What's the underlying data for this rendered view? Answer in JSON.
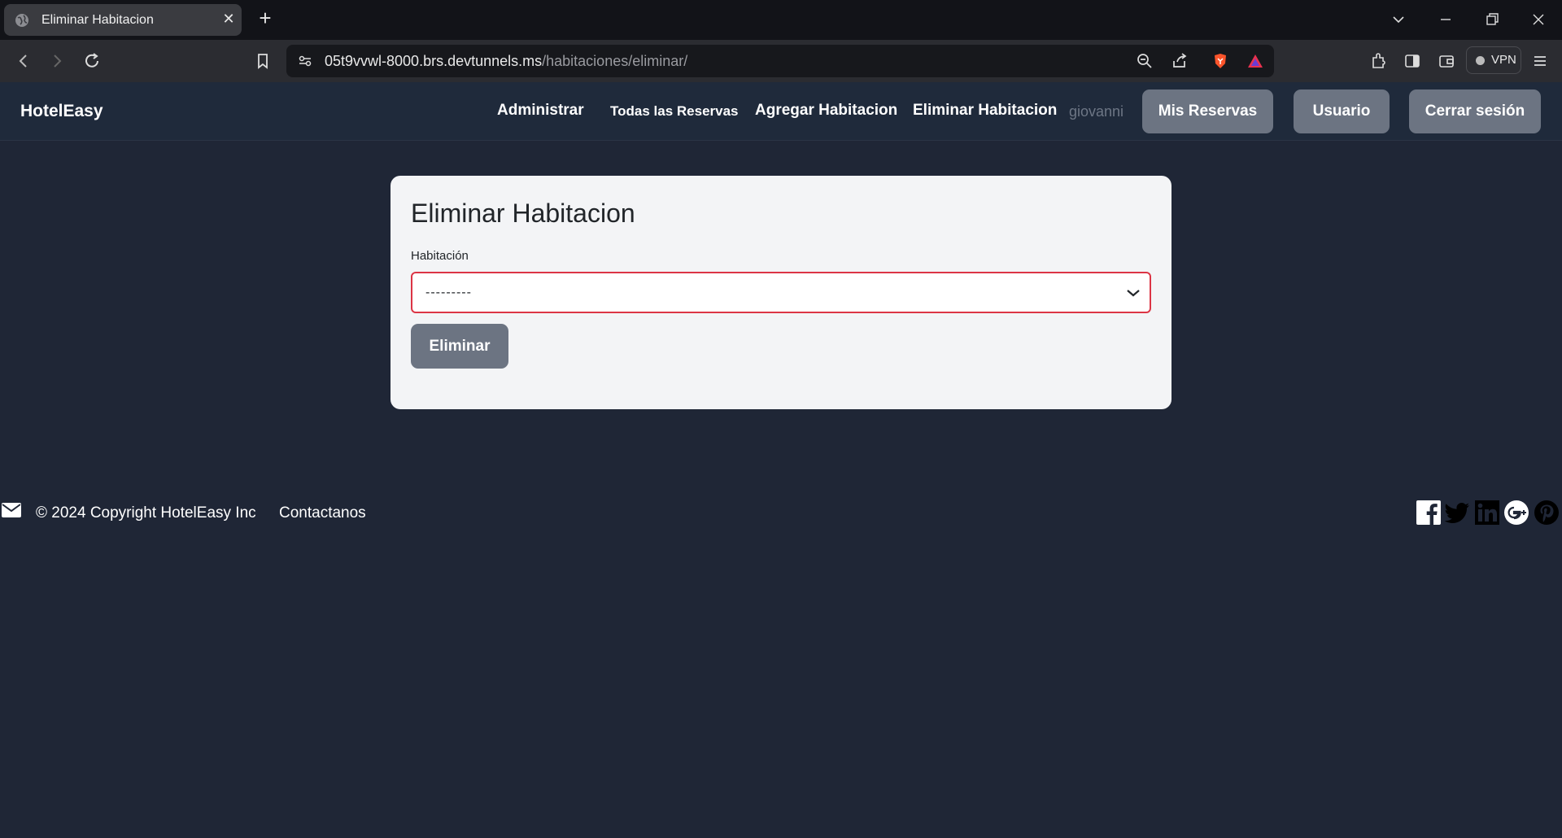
{
  "browser": {
    "tab_title": "Eliminar Habitacion",
    "url_host": "05t9vvwl-8000.brs.devtunnels.ms",
    "url_path": "/habitaciones/eliminar/",
    "vpn_label": "VPN"
  },
  "navbar": {
    "brand": "HotelEasy",
    "links": [
      "Administrar",
      "Todas las Reservas",
      "Agregar Habitacion",
      "Eliminar Habitacion"
    ],
    "username": "giovanni",
    "buttons": [
      "Mis Reservas",
      "Usuario",
      "Cerrar sesión"
    ]
  },
  "form": {
    "title": "Eliminar Habitacion",
    "field_label": "Habitación",
    "select_value": "---------",
    "submit_label": "Eliminar"
  },
  "footer": {
    "copyright": "© 2024 Copyright HotelEasy Inc",
    "contact": "Contactanos",
    "social_icons": [
      "facebook-icon",
      "twitter-icon",
      "linkedin-icon",
      "google-plus-icon",
      "pinterest-icon"
    ]
  },
  "colors": {
    "page_bg": "#1f2636",
    "navbar_bg": "#1f2a3b",
    "button_bg": "#6c7482",
    "card_bg": "#f3f4f6",
    "invalid_border": "#dc3545"
  }
}
